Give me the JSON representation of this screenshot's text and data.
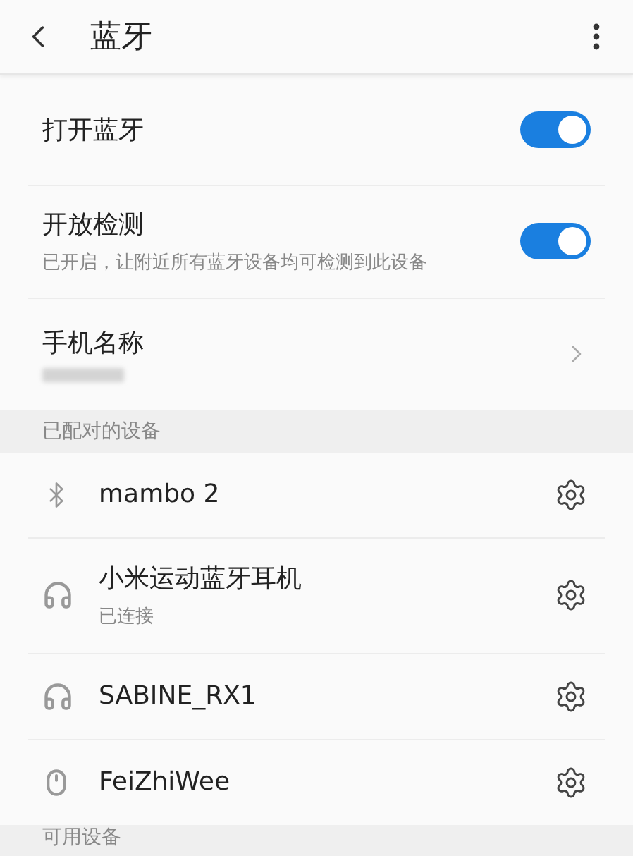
{
  "header": {
    "title": "蓝牙"
  },
  "settings": [
    {
      "kind": "toggle",
      "label": "打开蓝牙",
      "on": true
    },
    {
      "kind": "toggle",
      "label": "开放检测",
      "subtitle": "已开启，让附近所有蓝牙设备均可检测到此设备",
      "on": true
    },
    {
      "kind": "link",
      "label": "手机名称",
      "redacted_value": true
    }
  ],
  "paired_section": {
    "title": "已配对的设备"
  },
  "paired_devices": [
    {
      "kind": "bluetooth",
      "name": "mambo 2"
    },
    {
      "kind": "headphones",
      "name": "小米运动蓝牙耳机",
      "status": "已连接"
    },
    {
      "kind": "headphones",
      "name": "SABINE_RX1"
    },
    {
      "kind": "mouse",
      "name": "FeiZhiWee"
    }
  ],
  "available_section": {
    "title": "可用设备"
  }
}
